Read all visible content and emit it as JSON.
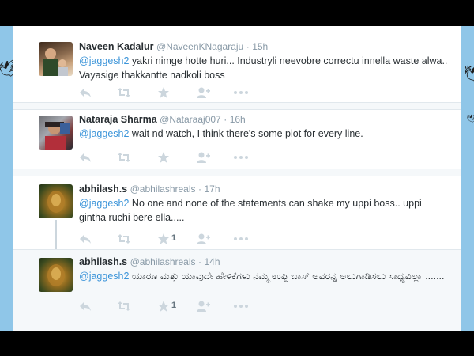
{
  "tweets": [
    {
      "name": "Naveen Kadalur",
      "handle": "@NaveenKNagaraju",
      "separator": "·",
      "time": "15h",
      "mention": "@jaggesh2",
      "text": " yakri nimge  hotte huri... Industryli neevobre correctu innella waste alwa.. Vayasige thakkantte nadkoli boss",
      "like_count": ""
    },
    {
      "name": "Nataraja Sharma",
      "handle": "@Nataraaj007",
      "separator": "·",
      "time": "16h",
      "mention": "@jaggesh2",
      "text": " wait nd watch, I think there's some plot for every line.",
      "like_count": ""
    },
    {
      "name": "abhilash.s",
      "handle": "@abhilashreals",
      "separator": "·",
      "time": "17h",
      "mention": "@jaggesh2",
      "text": " No one and none of the statements can shake my uppi boss.. uppi gintha ruchi bere ella.....",
      "like_count": "1"
    },
    {
      "name": "abhilash.s",
      "handle": "@abhilashreals",
      "separator": "·",
      "time": "14h",
      "mention": "@jaggesh2",
      "text": " ಯಾರೂ ಮತ್ತು ಯಾವುದೇ ಹೇಳಿಕೆಗಳು ನಮ್ಮ ಉಪ್ಪಿ ಬಾಸ್ ಅವರನ್ನ  ಅಲುಗಾಡಿಸಲು ಸಾಧ್ಯವಿಲ್ಲಾ .......",
      "like_count": "1"
    }
  ],
  "icons": [
    "reply-icon",
    "retweet-icon",
    "like-icon",
    "follow-icon",
    "more-icon"
  ],
  "colors": {
    "mention": "#3b94d9",
    "name": "#292f33",
    "meta": "#8899a6",
    "icon": "#ccd6dd",
    "page_bg": "#8fc6e8"
  }
}
